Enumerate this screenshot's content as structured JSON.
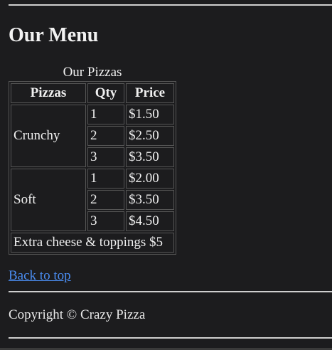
{
  "page": {
    "title": "Our Menu"
  },
  "menu_table": {
    "caption": "Our Pizzas",
    "headers": [
      "Pizzas",
      "Qty",
      "Price"
    ],
    "groups": [
      {
        "name": "Crunchy",
        "rows": [
          {
            "qty": "1",
            "price": "$1.50"
          },
          {
            "qty": "2",
            "price": "$2.50"
          },
          {
            "qty": "3",
            "price": "$3.50"
          }
        ]
      },
      {
        "name": "Soft",
        "rows": [
          {
            "qty": "1",
            "price": "$2.00"
          },
          {
            "qty": "2",
            "price": "$3.50"
          },
          {
            "qty": "3",
            "price": "$4.50"
          }
        ]
      }
    ],
    "footer": "Extra cheese & toppings $5"
  },
  "links": {
    "back_to_top": "Back to top"
  },
  "footer": {
    "copyright": "Copyright © Crazy Pizza"
  }
}
